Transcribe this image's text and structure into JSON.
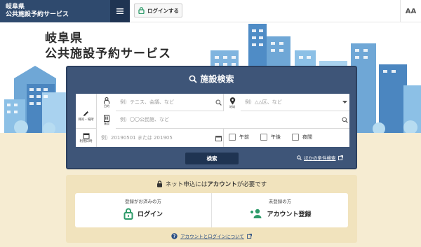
{
  "header": {
    "brand_line1": "岐阜県",
    "brand_line2": "公共施設予約サービス",
    "menu_icon": "menu-icon",
    "login_label": "ログインする",
    "font_size_label": "AA"
  },
  "hero": {
    "title_line1": "岐阜県",
    "title_line2": "公共施設予約サービス"
  },
  "search": {
    "title": "施設検索",
    "purpose_label": "目的・場所",
    "activity_caption": "目的",
    "activity_placeholder": "例）テニス、会議、など",
    "area_caption": "地域",
    "area_placeholder": "例）△△区、など",
    "facility_caption": "施設",
    "facility_placeholder": "例）〇〇公民館、など",
    "date_label": "利用日時",
    "date_placeholder": "例）20190501 または 201905",
    "time_slots": [
      "午前",
      "午後",
      "夜間"
    ],
    "submit_label": "検索",
    "more_conditions_label": "ほかの条件検索"
  },
  "account": {
    "note_prefix": "ネット申込には",
    "note_bold": "アカウント",
    "note_suffix": "が必要です",
    "registered_caption": "登録がお済みの方",
    "login_label": "ログイン",
    "unregistered_caption": "未登録の方",
    "register_label": "アカウント登録",
    "about_link": "アカウントとログインについて"
  },
  "colors": {
    "brand_navy": "#2f4a6e",
    "panel_blue": "#3e5578",
    "accent_green": "#2e9b6a",
    "beige": "#f6ecd2"
  }
}
